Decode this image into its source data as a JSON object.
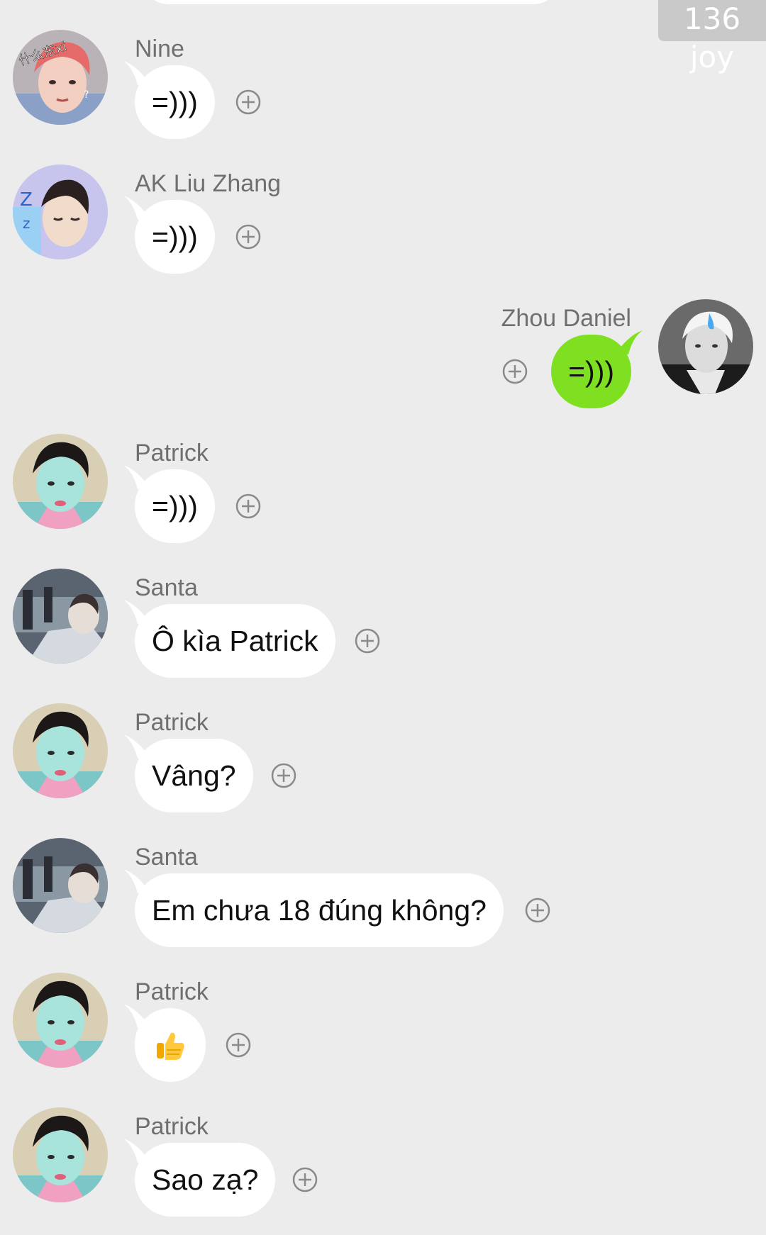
{
  "watermark": "136 joy",
  "colors": {
    "background": "#ececec",
    "bubble_incoming": "#ffffff",
    "bubble_outgoing": "#7ee020",
    "name_text": "#6f6f6f"
  },
  "messages": [
    {
      "sender": "Nine",
      "text": "=)))",
      "side": "left",
      "avatar": "nine-avatar"
    },
    {
      "sender": "AK Liu Zhang",
      "text": "=)))",
      "side": "left",
      "avatar": "ak-liu-zhang-avatar"
    },
    {
      "sender": "Zhou Daniel",
      "text": "=)))",
      "side": "right",
      "avatar": "zhou-daniel-avatar"
    },
    {
      "sender": "Patrick",
      "text": "=)))",
      "side": "left",
      "avatar": "patrick-avatar"
    },
    {
      "sender": "Santa",
      "text": "Ô kìa Patrick",
      "side": "left",
      "avatar": "santa-avatar"
    },
    {
      "sender": "Patrick",
      "text": "Vâng?",
      "side": "left",
      "avatar": "patrick-avatar"
    },
    {
      "sender": "Santa",
      "text": "Em chưa 18 đúng không?",
      "side": "left",
      "avatar": "santa-avatar"
    },
    {
      "sender": "Patrick",
      "text": "👍",
      "side": "left",
      "avatar": "patrick-avatar",
      "icon": "thumbs-up-icon"
    },
    {
      "sender": "Patrick",
      "text": "Sao zạ?",
      "side": "left",
      "avatar": "patrick-avatar"
    }
  ],
  "avatar_labels": {
    "nine": "什么东xi"
  }
}
